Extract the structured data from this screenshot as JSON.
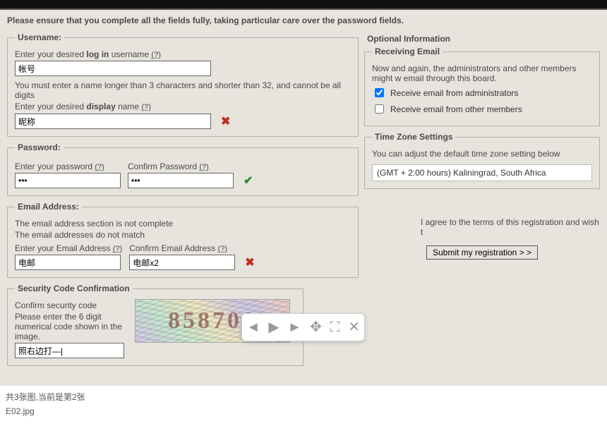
{
  "instruction": "Please ensure that you complete all the fields fully, taking particular care over the password fields.",
  "username": {
    "legend": "Username:",
    "desired_prefix": "Enter your desired ",
    "desired_bold": "log in",
    "desired_suffix": " username  ",
    "q": "(?)",
    "value": "帐号",
    "rule": "You must enter a name longer than 3 characters and shorter than 32, and cannot be all digits",
    "display_prefix": "Enter your desired ",
    "display_bold": "display",
    "display_suffix": " name  ",
    "display_value": "昵称"
  },
  "password": {
    "legend": "Password:",
    "enter": "Enter your password  ",
    "confirm": "Confirm Password  ",
    "q": "(?)",
    "value1": "•••",
    "value2": "•••"
  },
  "email": {
    "legend": "Email Address:",
    "err1": "The email address section is not complete",
    "err2": "The email addresses do not match",
    "enter": "Enter your Email Address  ",
    "confirm": "Confirm Email Address  ",
    "q": "(?)",
    "value1": "电邮",
    "value2": "电邮x2"
  },
  "security": {
    "legend": "Security Code Confirmation",
    "line1": "Confirm security code",
    "line2": "Please enter the 6 digit numerical code shown in the image.",
    "input_value": "照右边打—|",
    "captcha_text": "858700"
  },
  "optional": {
    "heading": "Optional Information",
    "receiving_legend": "Receiving Email",
    "receiving_desc": "Now and again, the administrators and other members might w email through this board.",
    "cb_admin": "Receive email from administrators",
    "cb_members": "Receive email from other members",
    "tz_legend": "Time Zone Settings",
    "tz_desc": "You can adjust the default time zone setting below",
    "tz_value": "(GMT + 2:00 hours) Kaliningrad, South Africa"
  },
  "agree": "I agree to the terms of this registration and wish t",
  "submit": "Submit my registration > >",
  "footer": {
    "counter": "共3张图,当前是第2张",
    "filename": "E02.jpg"
  }
}
